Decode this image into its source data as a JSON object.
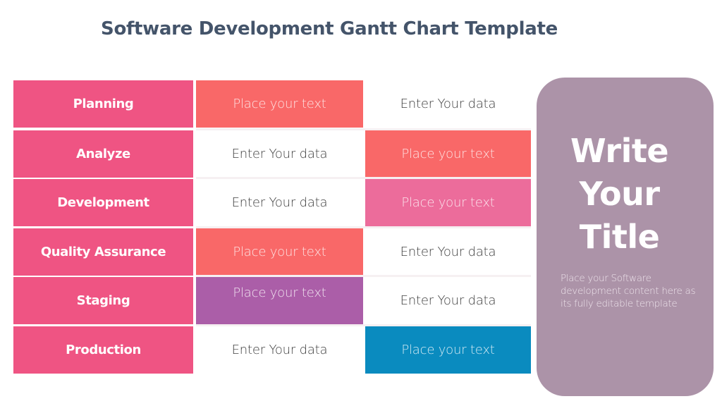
{
  "page": {
    "title": "Software Development Gantt Chart Template"
  },
  "colors": {
    "label_bg": "#ef5483",
    "coral": "#f96868",
    "pink": "#ec6c9b",
    "purple": "#ab5ea8",
    "blue": "#0a8bbf",
    "panel_bg": "#ac93a8",
    "title_text": "#44546a"
  },
  "rows": [
    {
      "label": "Planning",
      "cells": [
        {
          "text": "Place your text",
          "fill": "#f96868"
        },
        {
          "text": "Enter Your data",
          "fill": null
        }
      ]
    },
    {
      "label": "Analyze",
      "cells": [
        {
          "text": "Enter Your data",
          "fill": null
        },
        {
          "text": "Place your text",
          "fill": "#f96868"
        }
      ]
    },
    {
      "label": "Development",
      "cells": [
        {
          "text": "Enter Your data",
          "fill": null
        },
        {
          "text": "Place your text",
          "fill": "#ec6c9b"
        }
      ]
    },
    {
      "label": "Quality Assurance",
      "cells": [
        {
          "text": "Place your text",
          "fill": "#f96868"
        },
        {
          "text": "Enter Your data",
          "fill": null
        }
      ]
    },
    {
      "label": "Staging",
      "cells": [
        {
          "text": "Place your text",
          "fill": "#ab5ea8",
          "top_aligned": true
        },
        {
          "text": "Enter Your data",
          "fill": null
        }
      ]
    },
    {
      "label": "Production",
      "cells": [
        {
          "text": "Enter Your data",
          "fill": null
        },
        {
          "text": "Place your text",
          "fill": "#0a8bbf"
        }
      ]
    }
  ],
  "panel": {
    "title_lines": [
      "Write",
      "Your",
      "Title"
    ],
    "description": "Place your Software development content here as its fully  editable template"
  }
}
